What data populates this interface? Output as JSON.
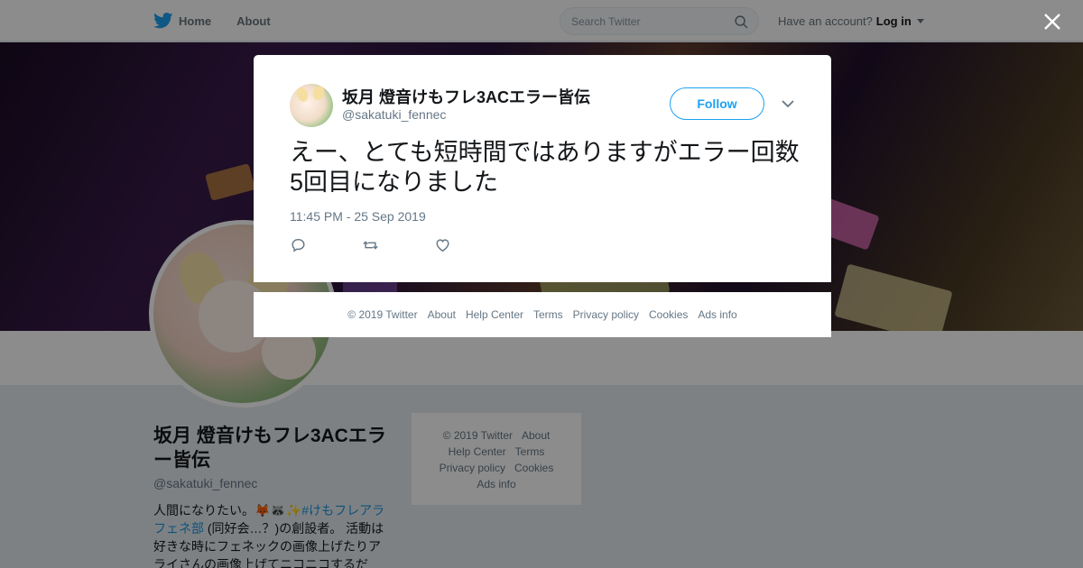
{
  "topbar": {
    "home_label": "Home",
    "about_label": "About",
    "search_placeholder": "Search Twitter",
    "account_prompt": "Have an account?",
    "login_label": "Log in"
  },
  "profile": {
    "display_name": "坂月 燈音けもフレ3ACエラー皆伝",
    "handle": "@sakatuki_fennec",
    "bio_prefix": "人間になりたい。🦊🦝✨",
    "bio_tag": "#けもフレアラフェネ部",
    "bio_rest": " (同好会…？)の創設者。 活動は好きな時にフェネックの画像上げたりアライさんの画像上げてニコニコするだ"
  },
  "sidebar_footer": {
    "copyright": "© 2019 Twitter",
    "about": "About",
    "help": "Help Center",
    "terms": "Terms",
    "privacy": "Privacy policy",
    "cookies": "Cookies",
    "ads": "Ads info"
  },
  "tweet": {
    "display_name": "坂月 燈音けもフレ3ACエラー皆伝",
    "handle": "@sakatuki_fennec",
    "follow_label": "Follow",
    "text": "えー、とても短時間ではありますがエラー回数5回目になりました",
    "timestamp": "11:45 PM - 25 Sep 2019"
  },
  "modal_footer": {
    "copyright": "© 2019 Twitter",
    "about": "About",
    "help": "Help Center",
    "terms": "Terms",
    "privacy": "Privacy policy",
    "cookies": "Cookies",
    "ads": "Ads info"
  },
  "colors": {
    "accent": "#1da1f2",
    "text_secondary": "#657786"
  }
}
